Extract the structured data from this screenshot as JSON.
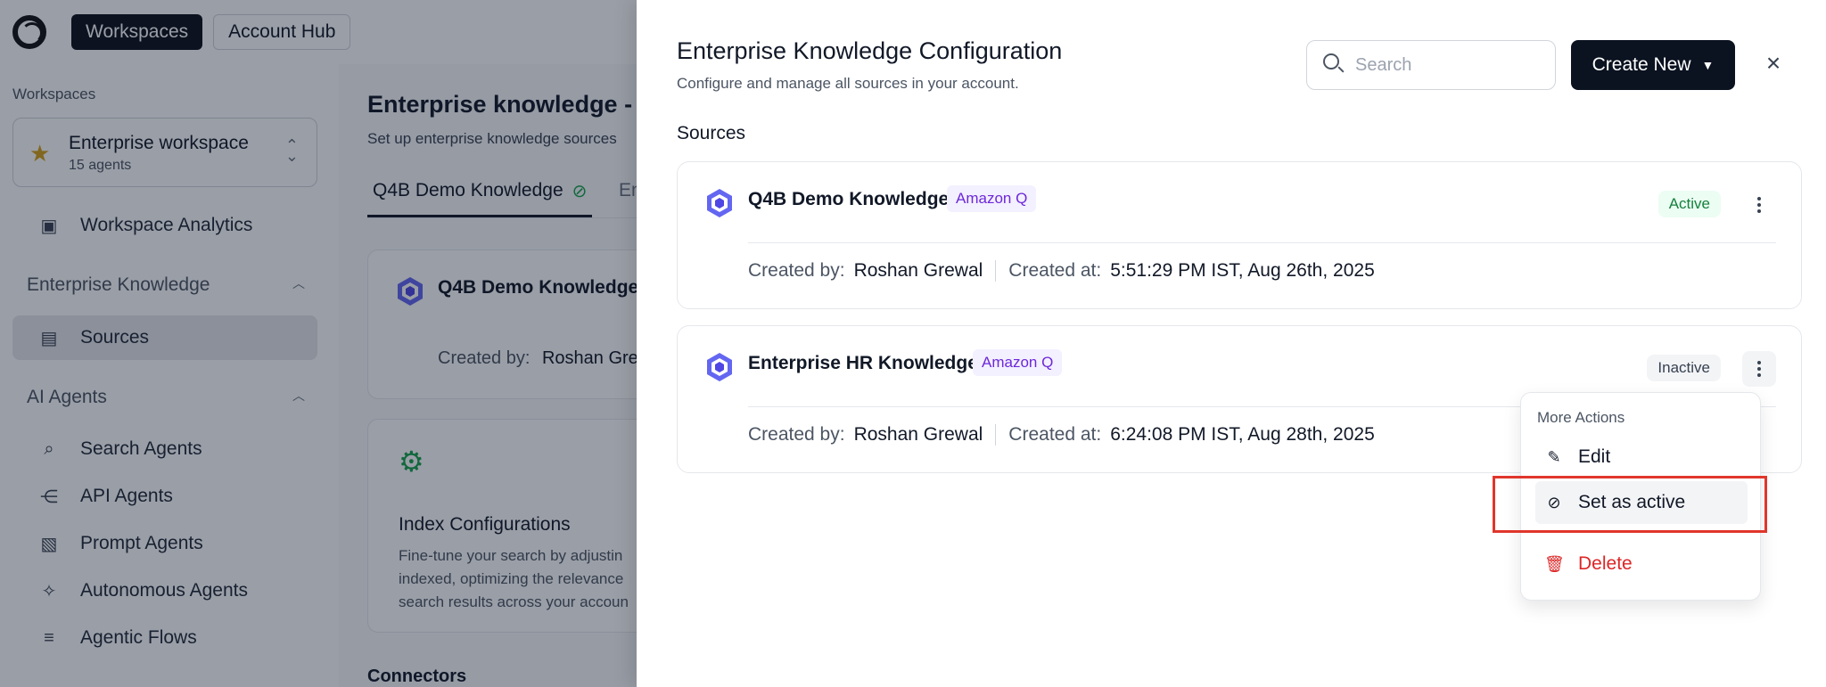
{
  "topbar": {
    "workspaces_label": "Workspaces",
    "account_hub_label": "Account Hub"
  },
  "sidebar": {
    "heading": "Workspaces",
    "workspace": {
      "name": "Enterprise workspace",
      "sub": "15 agents"
    },
    "analytics": "Workspace Analytics",
    "group_knowledge": "Enterprise Knowledge",
    "sources": "Sources",
    "group_agents": "AI Agents",
    "agents": [
      "Search Agents",
      "API Agents",
      "Prompt Agents",
      "Autonomous Agents",
      "Agentic Flows"
    ]
  },
  "main": {
    "title": "Enterprise knowledge - S",
    "subtitle": "Set up enterprise knowledge sources",
    "tab_active": "Q4B Demo Knowledge",
    "tab_next": "En",
    "card1": {
      "name": "Q4B Demo Knowledge",
      "created_by_label": "Created by:",
      "created_by": "Roshan Gre"
    },
    "card2": {
      "title": "Index Configurations",
      "desc": "Fine-tune your search by adjustin indexed, optimizing the relevance search results across your accoun"
    },
    "connectors": "Connectors"
  },
  "drawer": {
    "title": "Enterprise Knowledge Configuration",
    "subtitle": "Configure and manage all sources in your account.",
    "search_placeholder": "Search",
    "create_label": "Create New",
    "close_icon": "close-icon",
    "section": "Sources",
    "sources": [
      {
        "name": "Q4B Demo Knowledge",
        "tag": "Amazon Q",
        "status": "Active",
        "created_by_label": "Created by:",
        "created_by": "Roshan Grewal",
        "created_at_label": "Created at:",
        "created_at": "5:51:29 PM IST, Aug 26th, 2025"
      },
      {
        "name": "Enterprise HR Knowledge",
        "tag": "Amazon Q",
        "status": "Inactive",
        "created_by_label": "Created by:",
        "created_by": "Roshan Grewal",
        "created_at_label": "Created at:",
        "created_at": "6:24:08 PM IST, Aug 28th, 2025"
      }
    ],
    "menu": {
      "heading": "More Actions",
      "edit": "Edit",
      "set_active": "Set as active",
      "delete": "Delete"
    }
  },
  "colors": {
    "primary": "#0b1220",
    "active_green": "#15803d",
    "tag_purple": "#6d28d9",
    "danger": "#dc2626",
    "highlight": "#e0362c"
  }
}
